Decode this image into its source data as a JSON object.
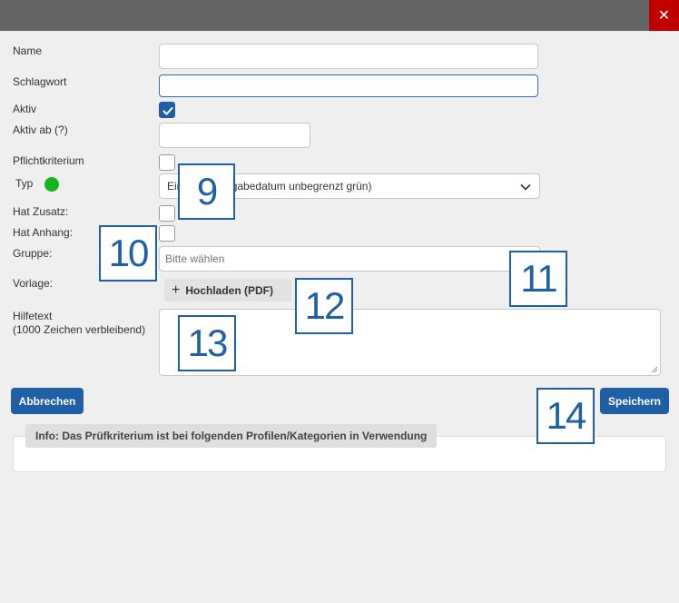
{
  "dialog": {
    "close_label": "✕"
  },
  "form": {
    "name_label": "Name",
    "schlagwort_label": "Schlagwort",
    "aktiv_label": "Aktiv",
    "aktiv_ab_label": "Aktiv ab (?)",
    "pflicht_label": "Pflichtkriterium",
    "typ_label": "Typ",
    "typ_value": "Einmalig (Eingabedatum unbegrenzt grün)",
    "hat_zusatz_label": "Hat Zusatz:",
    "hat_anhang_label": "Hat Anhang:",
    "gruppe_label": "Gruppe:",
    "gruppe_placeholder": "Bitte wählen",
    "vorlage_label": "Vorlage:",
    "upload_label": "Hochladen (PDF)",
    "hilfetext_label": "Hilfetext",
    "hilfetext_sub": "(1000 Zeichen verbleibend)",
    "name_value": "",
    "schlagwort_value": "",
    "aktiv_ab_value": "",
    "aktiv_checked": true,
    "typ_color": "#12b81a"
  },
  "actions": {
    "cancel_label": "Abbrechen",
    "save_label": "Speichern"
  },
  "info": {
    "text": "Info: Das Prüfkriterium ist bei folgenden Profilen/Kategorien in Verwendung"
  },
  "annotations": [
    "9",
    "10",
    "11",
    "12",
    "13",
    "14"
  ]
}
